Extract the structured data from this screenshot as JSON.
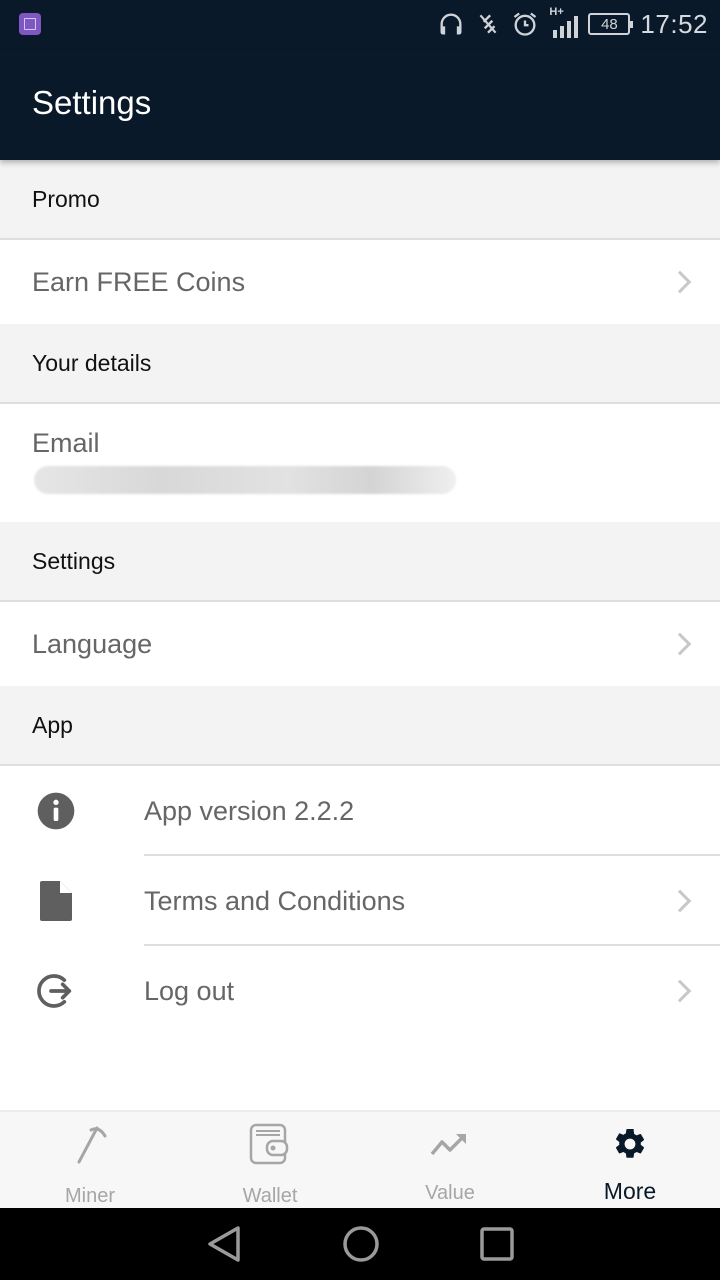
{
  "status_bar": {
    "time": "17:52",
    "battery_level": "48",
    "network_type": "H+",
    "icons": [
      "app-notification-icon",
      "headphones-icon",
      "vibrate-off-icon",
      "alarm-icon",
      "signal-icon",
      "battery-icon"
    ]
  },
  "app_bar": {
    "title": "Settings"
  },
  "sections": {
    "promo": {
      "header": "Promo",
      "items": [
        {
          "label": "Earn FREE Coins",
          "icon": "chevron-right-icon"
        }
      ]
    },
    "your_details": {
      "header": "Your details",
      "email_label": "Email",
      "email_value": "(redacted)"
    },
    "settings": {
      "header": "Settings",
      "items": [
        {
          "label": "Language",
          "icon": "chevron-right-icon"
        }
      ]
    },
    "app": {
      "header": "App",
      "items": [
        {
          "label": "App version 2.2.2",
          "icon": "info-icon"
        },
        {
          "label": "Terms and Conditions",
          "icon": "document-icon"
        },
        {
          "label": "Log out",
          "icon": "logout-icon"
        }
      ]
    }
  },
  "bottom_nav": {
    "items": [
      {
        "label": "Miner",
        "icon": "pickaxe-icon",
        "active": false
      },
      {
        "label": "Wallet",
        "icon": "wallet-icon",
        "active": false
      },
      {
        "label": "Value",
        "icon": "trending-up-icon",
        "active": false
      },
      {
        "label": "More",
        "icon": "gear-icon",
        "active": true
      }
    ]
  },
  "colors": {
    "app_bar": "#0a1929",
    "section_bg": "#f3f3f3",
    "row_text": "#666666",
    "active_nav": "#0a1929",
    "inactive_nav": "#a6a6a6"
  }
}
